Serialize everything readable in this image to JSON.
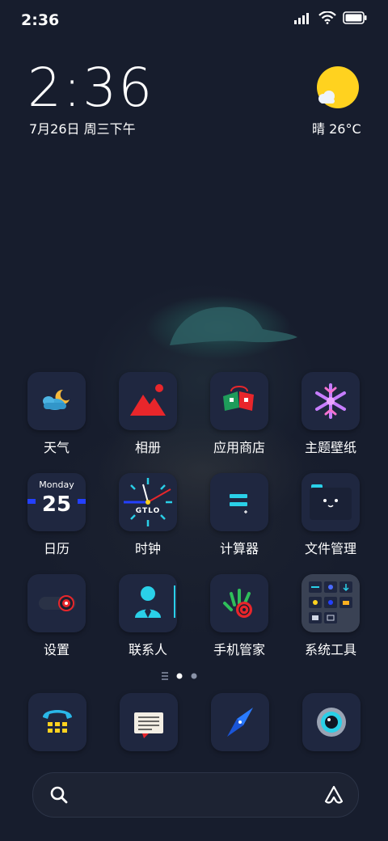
{
  "status_bar": {
    "time": "2:36"
  },
  "clock_widget": {
    "time": "2:36",
    "date": "7月26日 周三下午"
  },
  "weather_widget": {
    "text": "晴 26°C",
    "icon": "sun-cloud-icon"
  },
  "apps": [
    {
      "label": "天气",
      "icon": "weather-icon"
    },
    {
      "label": "相册",
      "icon": "gallery-icon"
    },
    {
      "label": "应用商店",
      "icon": "app-store-icon"
    },
    {
      "label": "主题壁纸",
      "icon": "themes-icon"
    },
    {
      "label": "日历",
      "icon": "calendar-icon",
      "weekday": "Monday",
      "day": "25"
    },
    {
      "label": "时钟",
      "icon": "clock-icon",
      "brand": "GTLO"
    },
    {
      "label": "计算器",
      "icon": "calculator-icon"
    },
    {
      "label": "文件管理",
      "icon": "file-manager-icon"
    },
    {
      "label": "设置",
      "icon": "settings-icon"
    },
    {
      "label": "联系人",
      "icon": "contacts-icon"
    },
    {
      "label": "手机管家",
      "icon": "security-icon"
    },
    {
      "label": "系统工具",
      "icon": "system-tools-folder-icon"
    }
  ],
  "pager": {
    "pages": 2,
    "current": 1
  },
  "dock": [
    {
      "icon": "phone-icon"
    },
    {
      "icon": "messages-icon"
    },
    {
      "icon": "browser-compass-icon"
    },
    {
      "icon": "camera-icon"
    }
  ],
  "colors": {
    "background": "#171d2d",
    "tile": "#1f2740",
    "accent_red": "#e8262b",
    "accent_cyan": "#2ad0e8",
    "sun": "#ffd21f"
  }
}
